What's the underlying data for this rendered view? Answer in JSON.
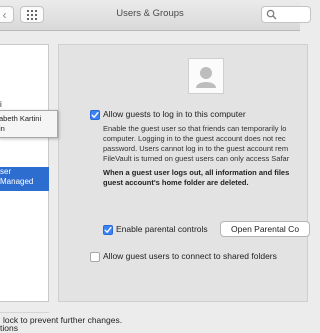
{
  "window": {
    "title": "Users & Groups"
  },
  "toolbar": {
    "back_glyph": "‹",
    "grid_icon": "grid-icon",
    "search_icon": "search-icon"
  },
  "sidebar": {
    "tooltip_lines": [
      "abeth Kartini",
      "in"
    ],
    "item_i": "i",
    "selected_line1": "ser",
    "selected_line2": "Managed",
    "options_label": "tions"
  },
  "guest": {
    "avatar_icon": "user-silhouette-icon",
    "allow_login_label": "Allow guests to log in to this computer",
    "allow_login_checked": true,
    "description": [
      "Enable the guest user so that friends can temporarily lo",
      "computer. Logging in to the guest account does not rec",
      "password. Users cannot log in to the guest account rem",
      "FileVault is turned on guest users can only access Safar"
    ],
    "warning": [
      "When a guest user logs out, all information and files",
      "guest account's home folder are deleted."
    ],
    "parental_label": "Enable parental controls",
    "parental_checked": true,
    "open_parental_button": "Open Parental Co",
    "shared_folders_label": "Allow guest users to connect to shared folders",
    "shared_folders_checked": false
  },
  "footer": {
    "lock_text": "lock to prevent further changes."
  },
  "colors": {
    "selection": "#2e6dd0",
    "checkbox_on": "#3b82f6",
    "panel_bg": "#e3e3e3"
  }
}
